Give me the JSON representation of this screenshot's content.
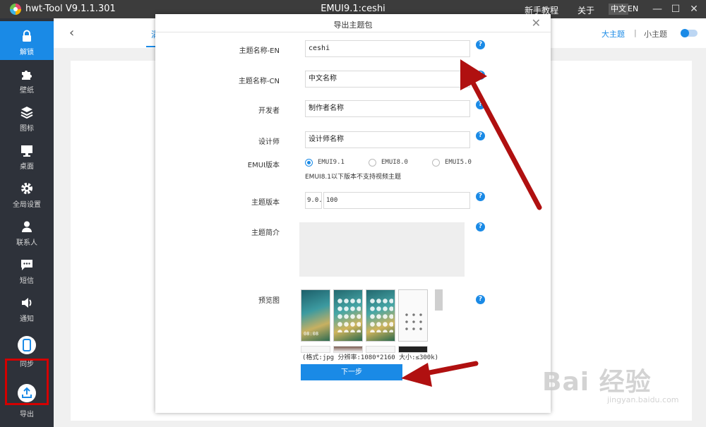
{
  "titlebar": {
    "app_title": "hwt-Tool V9.1.1.301",
    "center_title": "EMUI9.1:ceshi",
    "tutorial": "新手教程",
    "about": "关于",
    "lang_cn": "中文",
    "lang_en": "EN",
    "minimize": "—",
    "maximize": "☐",
    "close": "✕"
  },
  "sidebar": {
    "items": [
      {
        "label": "解锁",
        "icon": "lock-icon",
        "active": true
      },
      {
        "label": "壁纸",
        "icon": "puzzle-icon"
      },
      {
        "label": "图标",
        "icon": "layers-icon"
      },
      {
        "label": "桌面",
        "icon": "monitor-icon"
      },
      {
        "label": "全局设置",
        "icon": "gear-icon"
      },
      {
        "label": "联系人",
        "icon": "person-icon"
      },
      {
        "label": "短信",
        "icon": "message-icon"
      },
      {
        "label": "通知",
        "icon": "speaker-icon"
      },
      {
        "label": "同步",
        "icon": "phone-icon"
      },
      {
        "label": "导出",
        "icon": "upload-icon"
      }
    ]
  },
  "main": {
    "back": "‹",
    "tab_hint": "满",
    "big_theme": "大主题",
    "separator": "|",
    "small_theme": "小主题"
  },
  "modal": {
    "title": "导出主题包",
    "close": "✕",
    "fields": {
      "name_en": {
        "label": "主题名称-EN",
        "value": "ceshi"
      },
      "name_cn": {
        "label": "主题名称-CN",
        "value": "中文名称"
      },
      "developer": {
        "label": "开发者",
        "value": "制作者名称"
      },
      "designer": {
        "label": "设计师",
        "value": "设计师名称"
      }
    },
    "emui": {
      "label": "EMUI版本",
      "options": [
        "EMUI9.1",
        "EMUI8.0",
        "EMUI5.0"
      ],
      "selected": "EMUI9.1",
      "note": "EMUI8.1以下版本不支持视频主题"
    },
    "theme_version": {
      "label": "主题版本",
      "prefix": "9.0.",
      "value": "100"
    },
    "intro": {
      "label": "主题简介"
    },
    "preview": {
      "label": "预览图",
      "thumb_clock": "08:08",
      "format_note": "(格式:jpg 分辨率:1080*2160 大小:≤300k)"
    },
    "help": "?",
    "next_button": "下一步"
  },
  "watermark": {
    "main": "Bai 经验",
    "sub": "jingyan.baidu.com"
  },
  "colors": {
    "accent": "#1a8ae6",
    "sidebar_bg": "#2e323a",
    "titlebar_bg": "#3c3c3c",
    "annotation_red": "#b01010"
  }
}
